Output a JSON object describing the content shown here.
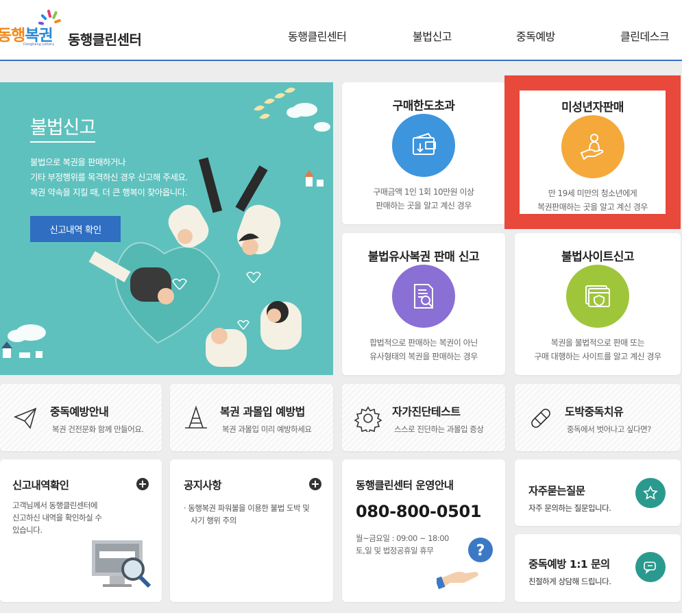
{
  "header": {
    "logo": {
      "part1": "동행",
      "part2": "복권",
      "sub": "Donghang Lottery"
    },
    "brand_name": "동행클린센터",
    "nav": [
      "동행클린센터",
      "불법신고",
      "중독예방",
      "클린데스크"
    ]
  },
  "hero": {
    "title": "불법신고",
    "desc_lines": [
      "불법으로 복권을 판매하거나",
      "기타 부정행위를 목격하신 경우 신고해 주세요.",
      "복권 약속을 지킬 때, 더 큰 행복이 찾아옵니다."
    ],
    "button": "신고내역 확인"
  },
  "report_cards": [
    {
      "title": "구매한도초과",
      "icon": "wallet-icon",
      "color": "#3d95dd",
      "desc": [
        "구매금액 1인 1회 10만원 이상",
        "판매하는 곳을 알고 계신 경우"
      ]
    },
    {
      "title": "미성년자판매",
      "icon": "child-hand-icon",
      "color": "#f5a93a",
      "desc": [
        "만 19세 미만의 청소년에게",
        "복권판매하는 곳을 알고 계신 경우"
      ]
    },
    {
      "title": "불법유사복권 판매 신고",
      "icon": "document-search-icon",
      "color": "#8a6fd4",
      "desc": [
        "합법적으로 판매하는 복권이 아닌",
        "유사형태의 복권을 판매하는 경우"
      ]
    },
    {
      "title": "불법사이트신고",
      "icon": "website-shield-icon",
      "color": "#9fc63a",
      "desc": [
        "복권을 불법적으로 판매 또는",
        "구매 대행하는 사이트를 알고 계신 경우"
      ]
    }
  ],
  "quick_links": [
    {
      "title": "중독예방안내",
      "sub": "복권 건전문화 함께 만들어요.",
      "icon": "paper-plane-icon"
    },
    {
      "title": "복권 과몰입 예방법",
      "sub": "복권 과몰입 미리 예방하세요",
      "icon": "traffic-cone-icon"
    },
    {
      "title": "자가진단테스트",
      "sub": "스스로 진단하는 과몰입 증상",
      "icon": "gear-icon"
    },
    {
      "title": "도박중독치유",
      "sub": "중독에서 벗어나고 싶다면?",
      "icon": "bandage-icon"
    }
  ],
  "report_history": {
    "title": "신고내역확인",
    "desc": [
      "고객님께서 동행클린센터에",
      "신고하신 내역을 확인하실 수",
      "있습니다."
    ]
  },
  "notice": {
    "title": "공지사항",
    "items": [
      [
        "동행복권 파워볼을 이용한 불법 도박 및",
        "사기 행위 주의"
      ]
    ]
  },
  "operation": {
    "title": "동행클린센터 운영안내",
    "phone": "080-800-0501",
    "hours": [
      "월~금요일 : 09:00 ~ 18:00",
      "토,일 및 법정공휴일 휴무"
    ]
  },
  "faq": {
    "title": "자주묻는질문",
    "desc": "자주 문의하는 질문입니다."
  },
  "inquiry": {
    "title": "중독예방 1:1 문의",
    "desc": "친절하게 상담해 드립니다."
  }
}
